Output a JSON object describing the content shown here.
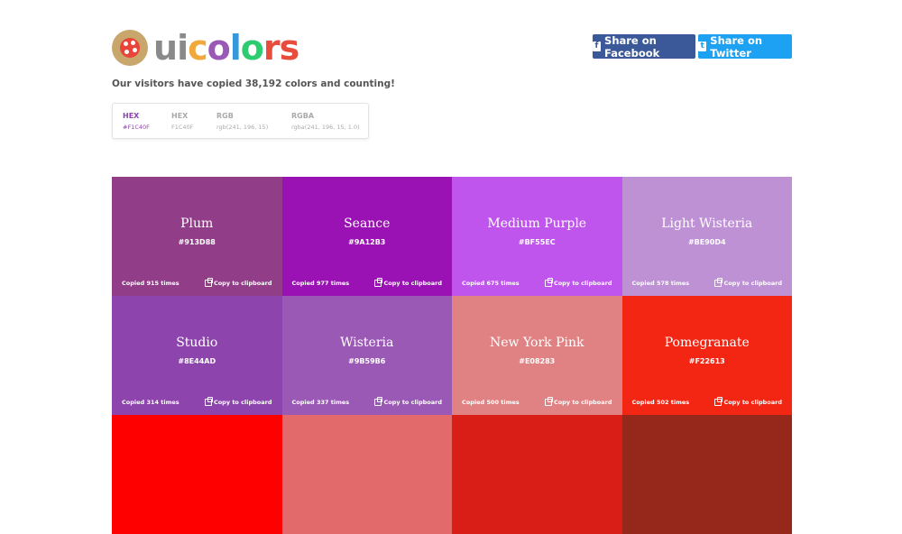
{
  "header": {
    "logo_letters": [
      {
        "ch": "u",
        "color": "#8a8a8a"
      },
      {
        "ch": "i",
        "color": "#8a8a8a"
      },
      {
        "ch": "c",
        "color": "#f2a93b"
      },
      {
        "ch": "o",
        "color": "#9b59b6"
      },
      {
        "ch": "l",
        "color": "#3498db"
      },
      {
        "ch": "o",
        "color": "#2ecc71"
      },
      {
        "ch": "r",
        "color": "#e74c3c"
      },
      {
        "ch": "s",
        "color": "#e74c3c"
      }
    ],
    "share_facebook": "Share on Facebook",
    "share_twitter": "Share on Twitter",
    "tagline": "Our visitors have copied 38,192 colors and counting!"
  },
  "formats": [
    {
      "name": "HEX",
      "value": "#F1C40F",
      "active": true
    },
    {
      "name": "HEX",
      "value": "F1C40F",
      "active": false
    },
    {
      "name": "RGB",
      "value": "rgb(241, 196, 15)",
      "active": false
    },
    {
      "name": "RGBA",
      "value": "rgba(241, 196, 15, 1.0)",
      "active": false
    }
  ],
  "copy_label": "Copy to clipboard",
  "colors": [
    {
      "name": "Plum",
      "hex": "#913D88",
      "copied": "Copied 915 times"
    },
    {
      "name": "Seance",
      "hex": "#9A12B3",
      "copied": "Copied 977 times"
    },
    {
      "name": "Medium Purple",
      "hex": "#BF55EC",
      "copied": "Copied 675 times"
    },
    {
      "name": "Light Wisteria",
      "hex": "#BE90D4",
      "copied": "Copied 578 times"
    },
    {
      "name": "Studio",
      "hex": "#8E44AD",
      "copied": "Copied 314 times"
    },
    {
      "name": "Wisteria",
      "hex": "#9B59B6",
      "copied": "Copied 337 times"
    },
    {
      "name": "New York Pink",
      "hex": "#E08283",
      "copied": "Copied 500 times"
    },
    {
      "name": "Pomegranate",
      "hex": "#F22613",
      "copied": "Copied 502 times"
    },
    {
      "name": "",
      "hex": "",
      "copied": "",
      "swatch": "#ff0000"
    },
    {
      "name": "",
      "hex": "",
      "copied": "",
      "swatch": "#e26a6a"
    },
    {
      "name": "",
      "hex": "",
      "copied": "",
      "swatch": "#d91e18"
    },
    {
      "name": "",
      "hex": "",
      "copied": "",
      "swatch": "#96281b"
    }
  ]
}
